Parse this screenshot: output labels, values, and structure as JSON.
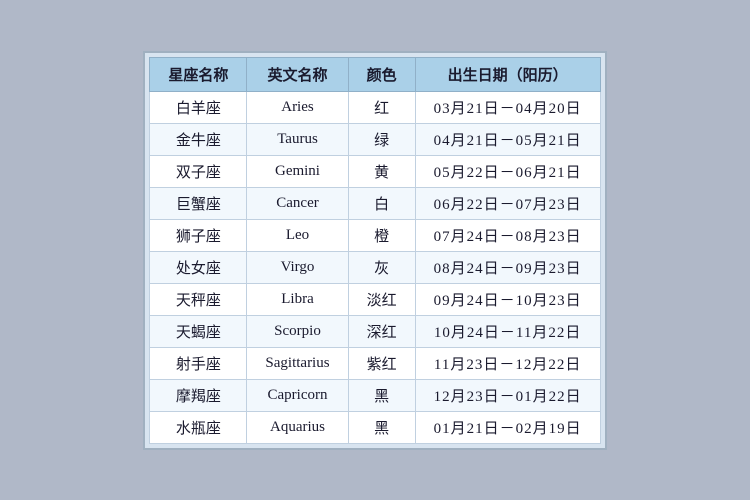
{
  "table": {
    "headers": [
      "星座名称",
      "英文名称",
      "颜色",
      "出生日期（阳历）"
    ],
    "rows": [
      {
        "cn": "白羊座",
        "en": "Aries",
        "color": "红",
        "date": "03月21日－04月20日"
      },
      {
        "cn": "金牛座",
        "en": "Taurus",
        "color": "绿",
        "date": "04月21日－05月21日"
      },
      {
        "cn": "双子座",
        "en": "Gemini",
        "color": "黄",
        "date": "05月22日－06月21日"
      },
      {
        "cn": "巨蟹座",
        "en": "Cancer",
        "color": "白",
        "date": "06月22日－07月23日"
      },
      {
        "cn": "狮子座",
        "en": "Leo",
        "color": "橙",
        "date": "07月24日－08月23日"
      },
      {
        "cn": "处女座",
        "en": "Virgo",
        "color": "灰",
        "date": "08月24日－09月23日"
      },
      {
        "cn": "天秤座",
        "en": "Libra",
        "color": "淡红",
        "date": "09月24日－10月23日"
      },
      {
        "cn": "天蝎座",
        "en": "Scorpio",
        "color": "深红",
        "date": "10月24日－11月22日"
      },
      {
        "cn": "射手座",
        "en": "Sagittarius",
        "color": "紫红",
        "date": "11月23日－12月22日"
      },
      {
        "cn": "摩羯座",
        "en": "Capricorn",
        "color": "黑",
        "date": "12月23日－01月22日"
      },
      {
        "cn": "水瓶座",
        "en": "Aquarius",
        "color": "黑",
        "date": "01月21日－02月19日"
      }
    ]
  }
}
